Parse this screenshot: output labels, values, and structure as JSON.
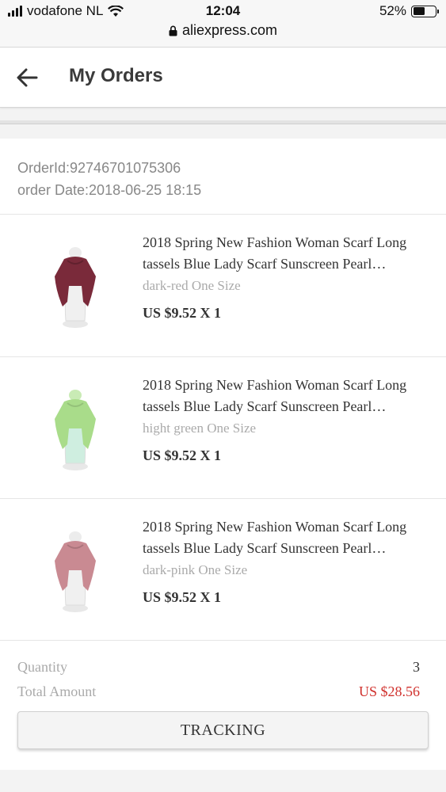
{
  "status_bar": {
    "carrier": "vodafone NL",
    "time": "12:04",
    "battery_percent": "52%",
    "battery_level": 0.52,
    "url": "aliexpress.com"
  },
  "header": {
    "title": "My Orders"
  },
  "order": {
    "order_id": "OrderId:92746701075306",
    "order_date": "order Date:2018-06-25 18:15"
  },
  "items": [
    {
      "title": "2018 Spring New Fashion Woman Scarf Long tassels Blue Lady Scarf Sunscreen Pearl…",
      "variant": "dark-red One Size",
      "price": "US $9.52 X 1",
      "color": "#7a2a3a"
    },
    {
      "title": "2018 Spring New Fashion Woman Scarf Long tassels Blue Lady Scarf Sunscreen Pearl…",
      "variant": "hight green One Size",
      "price": "US $9.52 X 1",
      "color": "#a9dc8a"
    },
    {
      "title": "2018 Spring New Fashion Woman Scarf Long tassels Blue Lady Scarf Sunscreen Pearl…",
      "variant": "dark-pink One Size",
      "price": "US $9.52 X 1",
      "color": "#c98a92"
    }
  ],
  "summary": {
    "quantity_label": "Quantity",
    "quantity_value": "3",
    "total_label": "Total Amount",
    "total_value": "US $28.56"
  },
  "actions": {
    "tracking_label": "TRACKING"
  },
  "colors": {
    "accent_red": "#d0312d"
  }
}
